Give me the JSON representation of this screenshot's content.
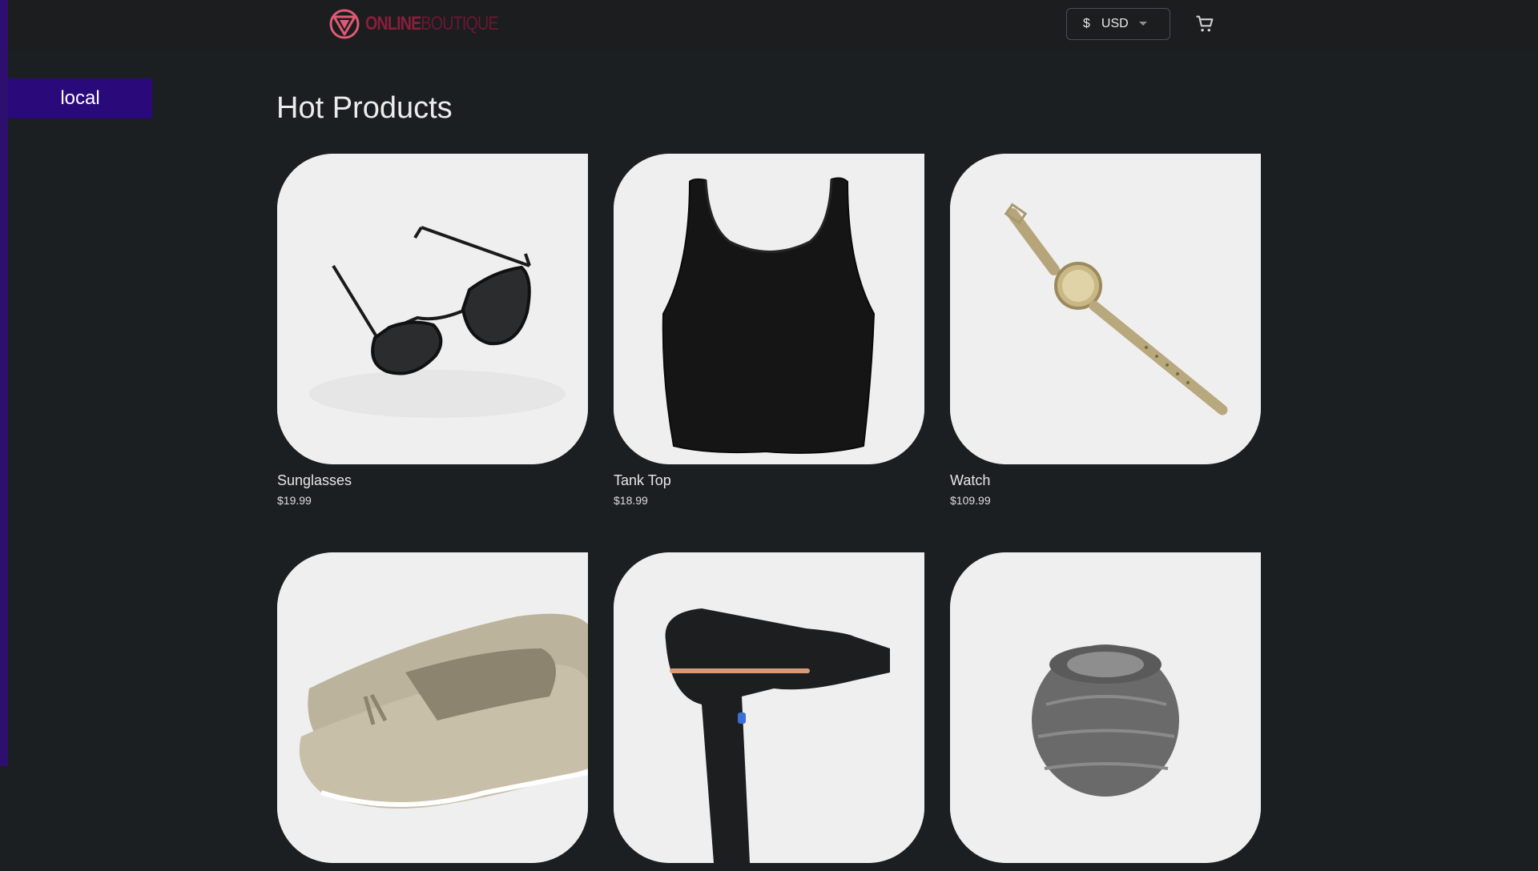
{
  "header": {
    "logo": {
      "text_bold": "ONLINE",
      "text_thin": "BOUTIQUE",
      "icon": "logo-triangle-icon"
    },
    "currency": {
      "symbol": "$",
      "code": "USD",
      "icon": "chevron-down-icon"
    },
    "cart_icon": "cart-icon"
  },
  "env_label": "local",
  "section_title": "Hot Products",
  "products": [
    {
      "name": "Sunglasses",
      "price": "$19.99"
    },
    {
      "name": "Tank Top",
      "price": "$18.99"
    },
    {
      "name": "Watch",
      "price": "$109.99"
    },
    {
      "name": "",
      "price": ""
    },
    {
      "name": "",
      "price": ""
    },
    {
      "name": "",
      "price": ""
    }
  ],
  "colors": {
    "background": "#1c1f21",
    "header": "#1b1d1f",
    "accent_purple": "#2a0a7a",
    "logo_red": "#8a1e3c"
  }
}
